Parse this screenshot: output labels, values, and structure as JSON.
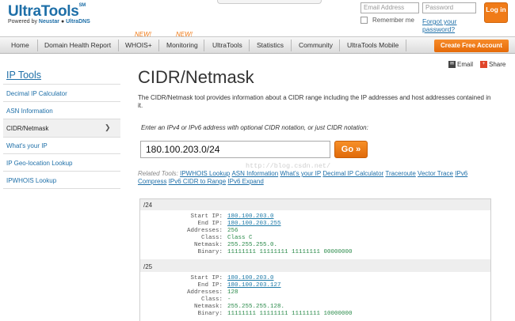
{
  "header": {
    "logo": "UltraTools",
    "logo_tm": "SM",
    "tagline_prefix": "Powered by",
    "tagline_neustar": "Neustar",
    "tagline_suffix": "UltraDNS",
    "email_placeholder": "Email Address",
    "password_placeholder": "Password",
    "remember_label": "Remember me",
    "forgot_label": "Forgot your password?",
    "login_label": "Log in"
  },
  "nav": {
    "items": [
      "Home",
      "Domain Health Report",
      "WHOIS+",
      "Monitoring",
      "UltraTools",
      "Statistics",
      "Community",
      "UltraTools Mobile"
    ],
    "new_badge": "NEW!",
    "cta": "Create Free Account"
  },
  "sidebar": {
    "title": "IP Tools",
    "items": [
      "Decimal IP Calculator",
      "ASN Information",
      "CIDR/Netmask",
      "What's your IP",
      "IP Geo-location Lookup",
      "IPWHOIS Lookup"
    ],
    "active_arrow": "❯"
  },
  "main": {
    "title": "CIDR/Netmask",
    "share_email": "Email",
    "share_share": "Share",
    "description": "The CIDR/Netmask tool provides information about a CIDR range including the IP addresses and host addresses contained in it.",
    "hint": "Enter an IPv4 or IPv6 address with optional CIDR notation, or just CIDR notation:",
    "input_value": "180.100.203.0/24",
    "go_label": "Go »",
    "related_label": "Related Tools:",
    "related": [
      "IPWHOIS Lookup",
      "ASN Information",
      "What's your IP",
      "Decimal IP Calculator",
      "Traceroute",
      "Vector Trace",
      "IPv6 Compress",
      "IPv6 CIDR to Range",
      "IPv6 Expand"
    ],
    "watermark": "http://blog.csdn.net/"
  },
  "results": [
    {
      "header": "/24",
      "rows": [
        {
          "label": "Start IP:",
          "value": "180.100.203.0",
          "link": true
        },
        {
          "label": "End IP:",
          "value": "180.100.203.255",
          "link": true
        },
        {
          "label": "Addresses:",
          "value": "256",
          "link": false
        },
        {
          "label": "Class:",
          "value": "Class C",
          "link": false
        },
        {
          "label": "Netmask:",
          "value": "255.255.255.0.",
          "link": false
        },
        {
          "label": "Binary:",
          "value": "11111111 11111111 11111111 00000000",
          "link": false
        }
      ]
    },
    {
      "header": "/25",
      "rows": [
        {
          "label": "Start IP:",
          "value": "180.100.203.0",
          "link": true
        },
        {
          "label": "End IP:",
          "value": "180.100.203.127",
          "link": true
        },
        {
          "label": "Addresses:",
          "value": "128",
          "link": false
        },
        {
          "label": "Class:",
          "value": "-",
          "link": false
        },
        {
          "label": "Netmask:",
          "value": "255.255.255.128.",
          "link": false
        },
        {
          "label": "Binary:",
          "value": "11111111 11111111 11111111 10000000",
          "link": false
        }
      ]
    }
  ],
  "colors": {
    "brand_blue": "#1e6fa8",
    "accent_orange": "#f07b18",
    "value_green": "#2a8a4a"
  }
}
